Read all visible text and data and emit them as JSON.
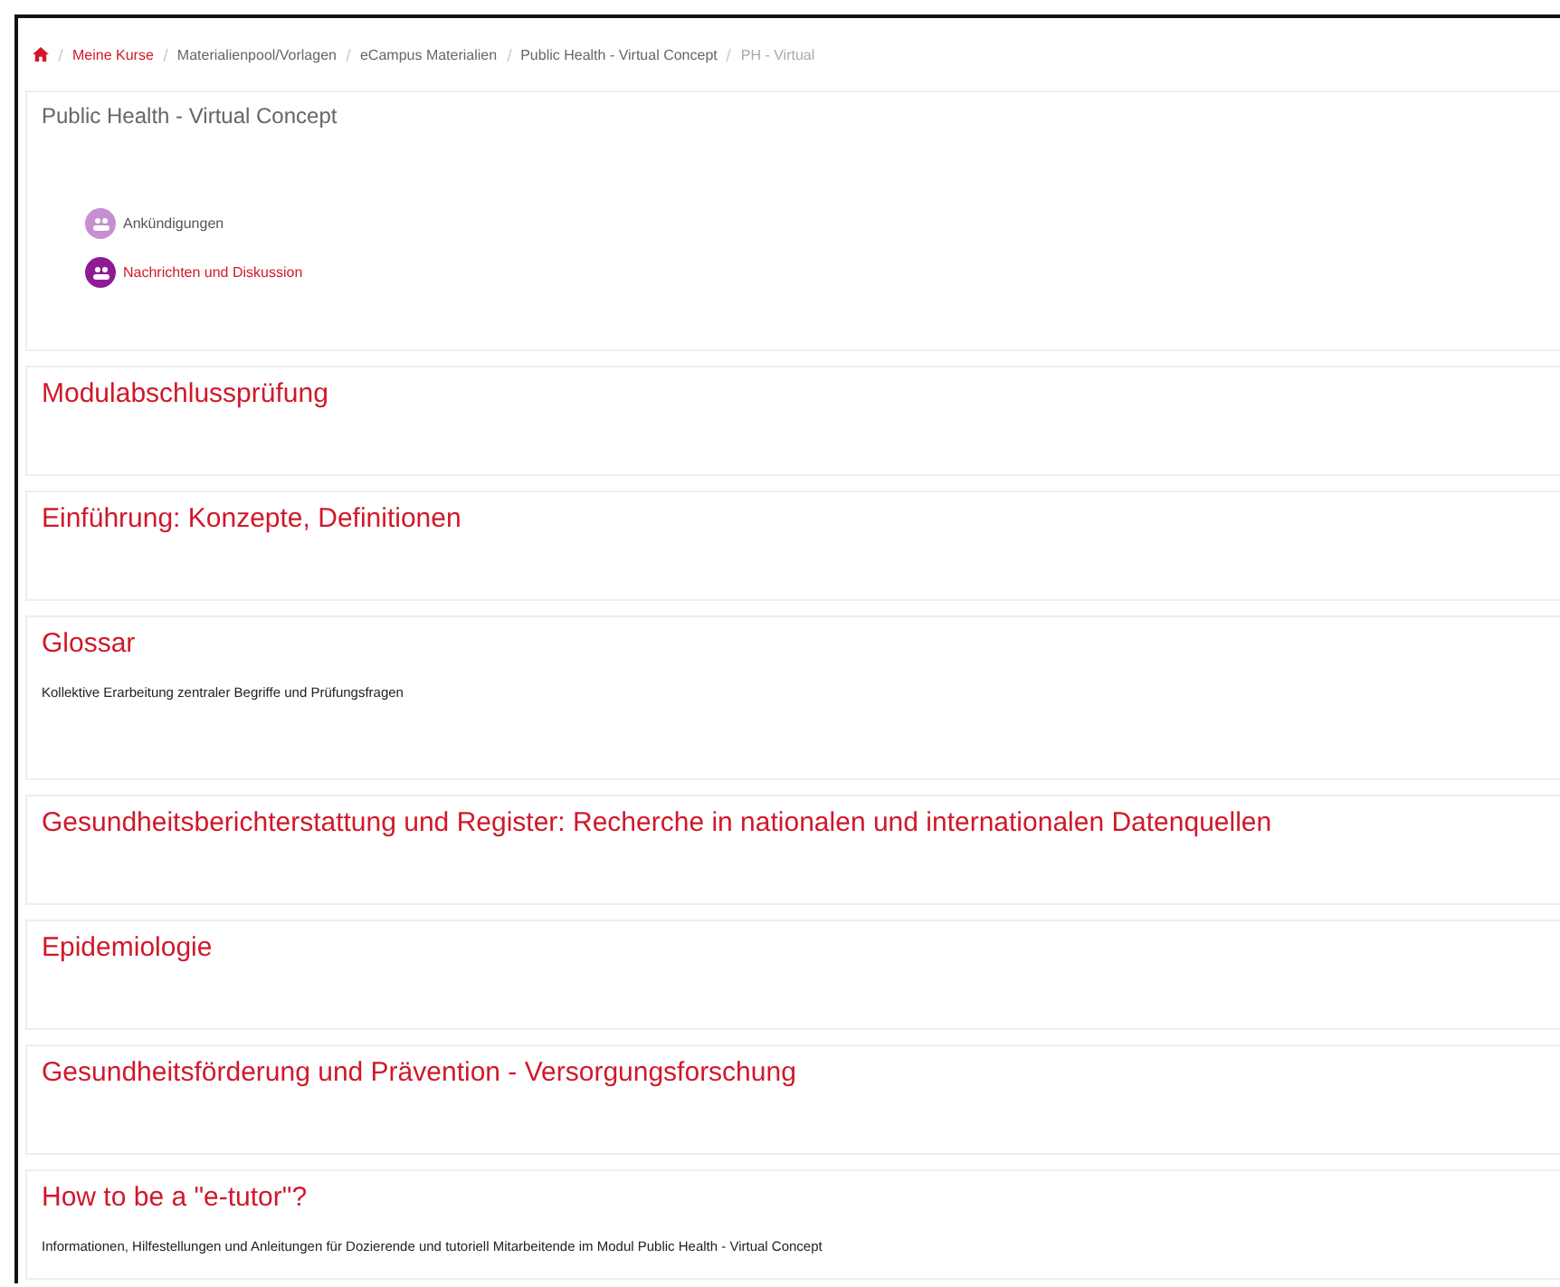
{
  "breadcrumb": [
    {
      "label": "Meine Kurse",
      "kind": "link"
    },
    {
      "label": "Materialienpool/Vorlagen",
      "kind": "plain"
    },
    {
      "label": "eCampus Materialien",
      "kind": "plain"
    },
    {
      "label": "Public Health - Virtual Concept",
      "kind": "plain"
    },
    {
      "label": "PH - Virtual",
      "kind": "current"
    }
  ],
  "course": {
    "title": "Public Health - Virtual Concept",
    "forums": [
      {
        "label": "Ankündigungen",
        "color": "#c58fd0",
        "kind": "plain"
      },
      {
        "label": "Nachrichten und Diskussion",
        "color": "#8e1a94",
        "kind": "link"
      }
    ]
  },
  "sections": [
    {
      "title": "Modulabschlussprüfung"
    },
    {
      "title": "Einführung: Konzepte, Definitionen"
    },
    {
      "title": "Glossar",
      "summary": "Kollektive Erarbeitung zentraler Begriffe und Prüfungsfragen"
    },
    {
      "title": "Gesundheitsberichterstattung und Register: Recherche in nationalen und internationalen Datenquellen"
    },
    {
      "title": "Epidemiologie"
    },
    {
      "title": "Gesundheitsförderung und Prävention - Versorgungsforschung"
    },
    {
      "title": "How to be a \"e-tutor\"?",
      "summary": "Informationen, Hilfestellungen und Anleitungen für Dozierende und tutoriell Mitarbeitende im Modul Public Health - Virtual Concept"
    }
  ]
}
